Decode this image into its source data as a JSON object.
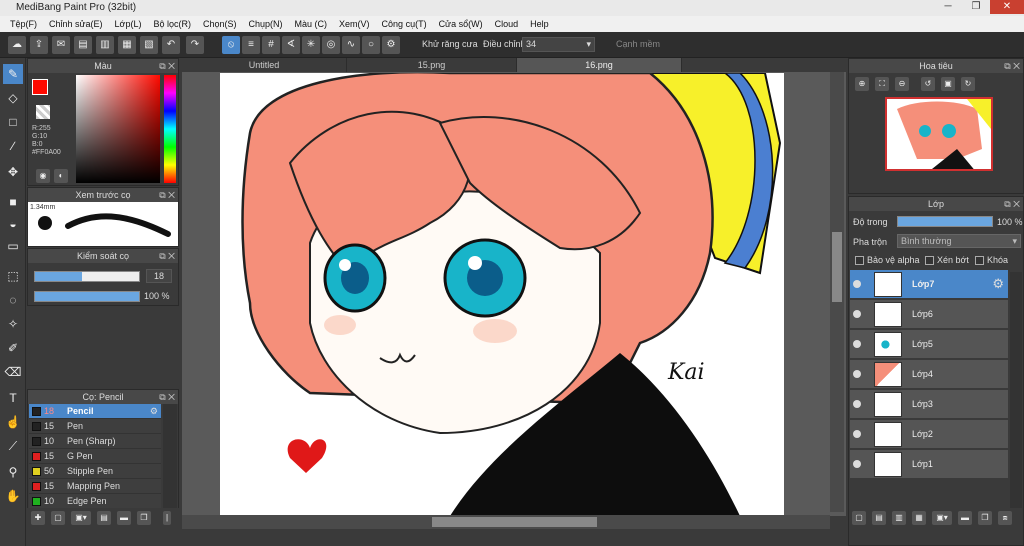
{
  "window": {
    "title": "MediBang Paint Pro (32bit)",
    "minimize": "─",
    "restore": "❐",
    "close": "✕"
  },
  "menu": [
    "Tệp(F)",
    "Chỉnh sửa(E)",
    "Lớp(L)",
    "Bộ lọc(R)",
    "Chọn(S)",
    "Chụp(N)",
    "Màu (C)",
    "Xem(V)",
    "Công cụ(T)",
    "Cửa sổ(W)",
    "Cloud",
    "Help"
  ],
  "toolbar": {
    "antialias_label": "Khử răng cưa",
    "correction_label": "Điều chỉnh",
    "correction_value": "34",
    "edge_label": "Cạnh mềm"
  },
  "color_panel": {
    "title": "Màu",
    "r": "R:255",
    "g": "G:10",
    "b": "B:0",
    "hex": "#FF0A00",
    "primary": "#ff0a00"
  },
  "brush_preview": {
    "title": "Xem trước cọ",
    "size": "1.34mm"
  },
  "brush_control": {
    "title": "Kiểm soát cọ",
    "size_value": "18",
    "opacity_value": "100 %",
    "size_fill": 0.45,
    "opacity_fill": 1.0
  },
  "brush_panel": {
    "title": "Cọ: Pencil",
    "items": [
      {
        "size": "18",
        "name": "Pencil",
        "color": "#222222",
        "sel": true
      },
      {
        "size": "15",
        "name": "Pen",
        "color": "#222222",
        "sel": false
      },
      {
        "size": "10",
        "name": "Pen (Sharp)",
        "color": "#222222",
        "sel": false
      },
      {
        "size": "15",
        "name": "G Pen",
        "color": "#e02020",
        "sel": false
      },
      {
        "size": "50",
        "name": "Stipple Pen",
        "color": "#e0d020",
        "sel": false
      },
      {
        "size": "15",
        "name": "Mapping Pen",
        "color": "#e02020",
        "sel": false
      },
      {
        "size": "10",
        "name": "Edge Pen",
        "color": "#20b020",
        "sel": false
      }
    ]
  },
  "tabs": [
    "Untitled",
    "15.png",
    "16.png"
  ],
  "navigator": {
    "title": "Hoa tiêu"
  },
  "layers": {
    "title": "Lớp",
    "opacity_label": "Độ trong",
    "opacity_value": "100 %",
    "blend_label": "Pha trộn",
    "blend_value": "Bình thường",
    "protect_alpha": "Bảo vệ alpha",
    "clipping": "Xén bớt",
    "lock": "Khóa",
    "items": [
      "Lớp7",
      "Lớp6",
      "Lớp5",
      "Lớp4",
      "Lớp3",
      "Lớp2",
      "Lớp1"
    ]
  },
  "canvas": {
    "signature": "Kai"
  }
}
